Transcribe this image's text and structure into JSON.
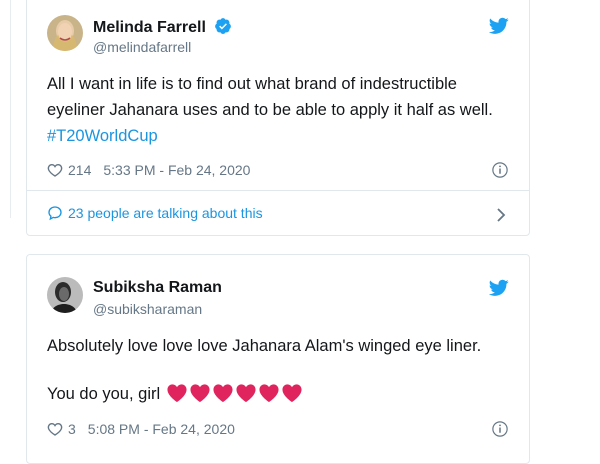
{
  "tweets": [
    {
      "name": "Melinda Farrell",
      "handle": "@melindafarrell",
      "verified": true,
      "text": "All I want in life is to find out what brand of indestructible eyeliner Jahanara uses and to be able to apply it half as well.",
      "hashtag": "#T20WorldCup",
      "likes": "214",
      "timestamp": "5:33 PM - Feb 24, 2020",
      "talking": "23 people are talking about this"
    },
    {
      "name": "Subiksha Raman",
      "handle": "@subiksharaman",
      "verified": false,
      "text": "Absolutely love love love Jahanara Alam's winged eye liner.",
      "text2": "You do you, girl",
      "heart_emoji_count": 6,
      "likes": "3",
      "timestamp": "5:08 PM - Feb 24, 2020"
    }
  ],
  "colors": {
    "twitter_blue": "#1da1f2",
    "link_blue": "#1b95e0",
    "heart_red": "#e0245e",
    "muted": "#657786"
  },
  "icons": [
    "twitter-bird-icon",
    "verified-badge-icon",
    "heart-outline-icon",
    "info-icon",
    "speech-bubble-icon",
    "chevron-right-icon",
    "red-heart-emoji-icon"
  ]
}
